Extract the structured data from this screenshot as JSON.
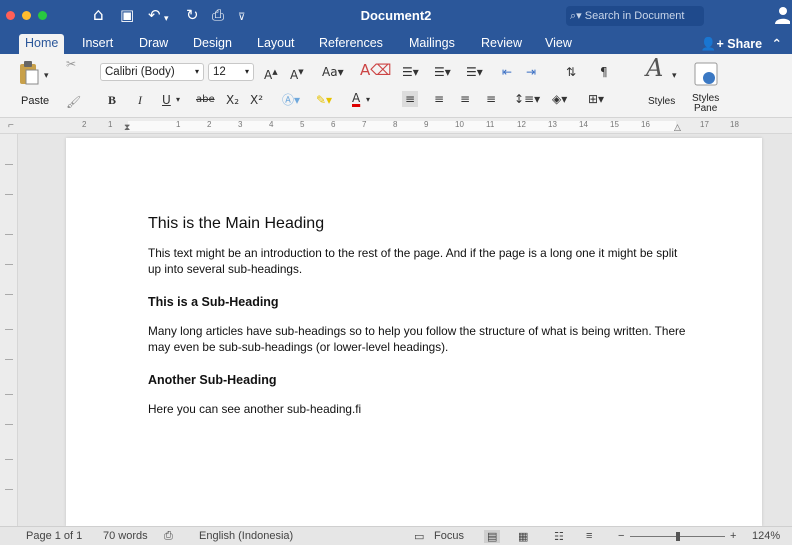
{
  "window": {
    "title": "Document2",
    "search_placeholder": "Search in Document"
  },
  "ribbon_tabs": [
    "Home",
    "Insert",
    "Draw",
    "Design",
    "Layout",
    "References",
    "Mailings",
    "Review",
    "View"
  ],
  "active_tab": "Home",
  "share_label": "Share",
  "ribbon": {
    "paste_label": "Paste",
    "font_name": "Calibri (Body)",
    "font_size": "12",
    "styles_label": "Styles",
    "styles_pane_label_1": "Styles",
    "styles_pane_label_2": "Pane",
    "bold": "B",
    "italic": "I",
    "underline": "U",
    "strike": "abe",
    "subscript": "X₂",
    "superscript": "X²"
  },
  "ruler_numbers": [
    "2",
    "1",
    "1",
    "2",
    "3",
    "4",
    "5",
    "6",
    "7",
    "8",
    "9",
    "10",
    "11",
    "12",
    "13",
    "14",
    "15",
    "16",
    "17",
    "18"
  ],
  "document": {
    "heading": "This is the Main Heading",
    "intro": "This text might be an introduction to the rest of the page. And if the page is a long one it might be split up into several sub-headings.",
    "sub1": "This is a Sub-Heading",
    "para1": "Many long articles have sub-headings so to help you follow the structure of what is being written. There may even be sub-sub-headings (or lower-level headings).",
    "sub2": "Another Sub-Heading",
    "para2": "Here you can see another sub-heading.fi"
  },
  "status": {
    "page": "Page 1 of 1",
    "words": "70 words",
    "language": "English (Indonesia)",
    "focus": "Focus",
    "zoom": "124%"
  },
  "colors": {
    "titlebar": "#2b579a",
    "ribbon": "#f3f3f3"
  }
}
